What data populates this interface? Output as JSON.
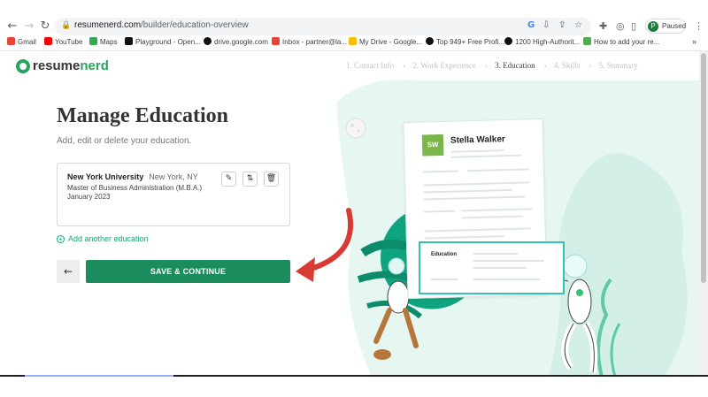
{
  "browser": {
    "url_domain": "resumenerd.com",
    "url_path": "/builder/education-overview",
    "profile_initial": "P",
    "profile_status": "Paused",
    "bookmarks": [
      {
        "label": "Gmail",
        "color": "#ea4335"
      },
      {
        "label": "YouTube",
        "color": "#ff0000"
      },
      {
        "label": "Maps",
        "color": "#34a853"
      },
      {
        "label": "Playground - Open...",
        "color": "#111111"
      },
      {
        "label": "drive.google.com",
        "color": "#111111"
      },
      {
        "label": "Inbox - partner@la...",
        "color": "#ea4335"
      },
      {
        "label": "My Drive - Google...",
        "color": "#fbbc04"
      },
      {
        "label": "Top 949+ Free Profi...",
        "color": "#111111"
      },
      {
        "label": "1200 High-Authorit...",
        "color": "#111111"
      },
      {
        "label": "How to add your re...",
        "color": "#4caf50"
      }
    ]
  },
  "app": {
    "logo_part1": "resume",
    "logo_part2": "nerd",
    "steps": [
      {
        "label": "1. Contact Info",
        "active": false
      },
      {
        "label": "2. Work Experience",
        "active": false
      },
      {
        "label": "3. Education",
        "active": true
      },
      {
        "label": "4. Skills",
        "active": false
      },
      {
        "label": "5. Summary",
        "active": false
      }
    ],
    "page_title": "Manage Education",
    "page_subtitle": "Add, edit or delete your education.",
    "education": {
      "school": "New York University",
      "location": "New York, NY",
      "degree": "Master of Business Administration (M.B.A.)",
      "date": "January 2023"
    },
    "add_another": "Add another education",
    "save_label": "SAVE & CONTINUE",
    "back_icon": "arrow-left-icon"
  },
  "illustration": {
    "resume_initials": "SW",
    "resume_name": "Stella Walker",
    "education_label": "Education"
  },
  "colors": {
    "brand_green": "#2aa45f",
    "button_green": "#1a8c5d",
    "accent_teal": "#35c2b2",
    "arrow_red": "#d83a34"
  }
}
